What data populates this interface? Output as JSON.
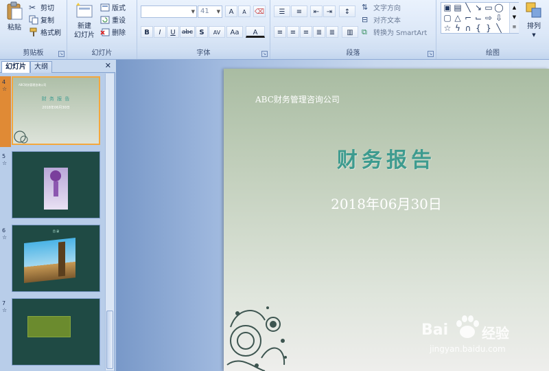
{
  "ribbon": {
    "clipboard": {
      "paste": "粘贴",
      "cut": "剪切",
      "copy": "复制",
      "format_painter": "格式刷",
      "label": "剪贴板"
    },
    "slides": {
      "new_slide": "新建",
      "new_slide_2": "幻灯片",
      "layout": "版式",
      "reset": "重设",
      "delete": "删除",
      "label": "幻灯片"
    },
    "font": {
      "font_size": "41",
      "bold": "B",
      "italic": "I",
      "underline": "U",
      "strike": "abc",
      "shadow": "S",
      "spacing": "AV",
      "case": "Aa",
      "color": "A",
      "grow": "A",
      "shrink": "A",
      "label": "字体"
    },
    "paragraph": {
      "text_direction": "文字方向",
      "align_text": "对齐文本",
      "smartart": "转换为 SmartArt",
      "label": "段落"
    },
    "drawing": {
      "arrange": "排列",
      "label": "绘图"
    }
  },
  "pane": {
    "tab_slides": "幻灯片",
    "tab_outline": "大纲",
    "close": "✕",
    "slides": [
      {
        "num": "4",
        "title": "财 务 报 告",
        "date": "2018年06月30日",
        "company": "ABC财务管理咨询公司"
      },
      {
        "num": "5"
      },
      {
        "num": "6",
        "title": "目 录"
      },
      {
        "num": "7"
      }
    ]
  },
  "slide": {
    "company": "ABC财务管理咨询公司",
    "title": "财务报告",
    "date": "2018年06月30日"
  },
  "watermark": {
    "brand": "Bai",
    "brand2": "经验",
    "url": "jingyan.baidu.com"
  },
  "colors": {
    "accent": "#3d9b8f",
    "slide_dark": "#1f4a44",
    "selection": "#f4a73c"
  }
}
